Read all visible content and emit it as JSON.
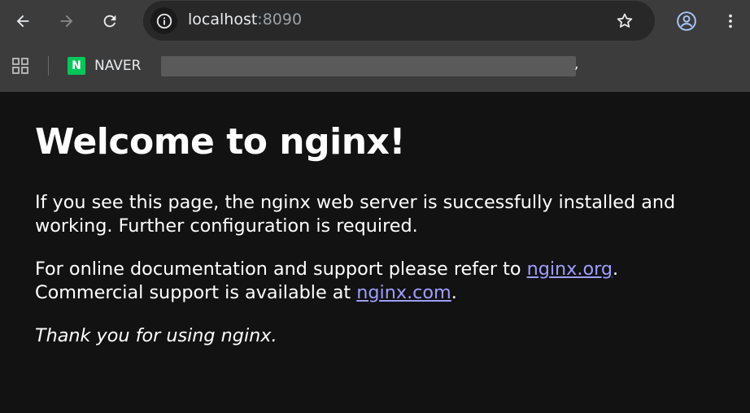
{
  "browser": {
    "url_host": "localhost",
    "url_port": ":8090",
    "bookmarks": [
      {
        "label": "NAVER",
        "badge": "N",
        "badge_color": "#03c75a"
      }
    ],
    "redacted_suffix": ","
  },
  "page": {
    "heading": "Welcome to nginx!",
    "intro_line1": "If you see this page, the nginx web server is successfully installed and",
    "intro_line2": "working. Further configuration is required.",
    "docs_prefix": "For online documentation and support please refer to ",
    "docs_link": "nginx.org",
    "docs_suffix": ".",
    "commercial_prefix": "Commercial support is available at ",
    "commercial_link": "nginx.com",
    "commercial_suffix": ".",
    "thanks": "Thank you for using nginx."
  },
  "colors": {
    "background": "#121212",
    "link": "#9e9eff",
    "toolbar": "#3c3c3c"
  }
}
